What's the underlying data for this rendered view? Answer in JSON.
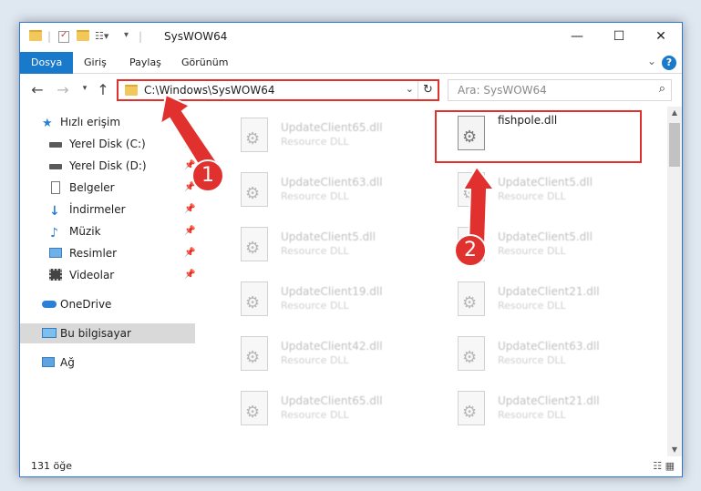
{
  "window": {
    "title": "SysWOW64",
    "minimize_glyph": "—",
    "maximize_glyph": "☐",
    "close_glyph": "✕"
  },
  "ribbon": {
    "tabs": [
      {
        "label": "Dosya",
        "active": true
      },
      {
        "label": "Giriş",
        "active": false
      },
      {
        "label": "Paylaş",
        "active": false
      },
      {
        "label": "Görünüm",
        "active": false
      }
    ],
    "help_glyph": "?"
  },
  "address": {
    "path": "C:\\Windows\\SysWOW64",
    "search_placeholder": "Ara: SysWOW64"
  },
  "sidebar": {
    "items": [
      {
        "label": "Hızlı erişim",
        "icon": "star-icon",
        "pinned": false
      },
      {
        "label": "Yerel Disk (C:)",
        "icon": "drive-icon",
        "pinned": true
      },
      {
        "label": "Yerel Disk (D:)",
        "icon": "drive-icon",
        "pinned": true
      },
      {
        "label": "Belgeler",
        "icon": "documents-icon",
        "pinned": true
      },
      {
        "label": "İndirmeler",
        "icon": "download-icon",
        "pinned": true
      },
      {
        "label": "Müzik",
        "icon": "music-icon",
        "pinned": true
      },
      {
        "label": "Resimler",
        "icon": "pictures-icon",
        "pinned": true
      },
      {
        "label": "Videolar",
        "icon": "videos-icon",
        "pinned": true
      },
      {
        "label": "OneDrive",
        "icon": "cloud-icon",
        "pinned": false
      },
      {
        "label": "Bu bilgisayar",
        "icon": "computer-icon",
        "pinned": false,
        "selected": true
      },
      {
        "label": "Ağ",
        "icon": "network-icon",
        "pinned": false
      }
    ]
  },
  "files": {
    "left": [
      {
        "name": "UpdateClient65.dll",
        "type": "Resource DLL"
      },
      {
        "name": "UpdateClient63.dll",
        "type": "Resource DLL"
      },
      {
        "name": "UpdateClient5.dll",
        "type": "Resource DLL"
      },
      {
        "name": "UpdateClient19.dll",
        "type": "Resource DLL"
      },
      {
        "name": "UpdateClient42.dll",
        "type": "Resource DLL"
      },
      {
        "name": "UpdateClient65.dll",
        "type": "Resource DLL"
      }
    ],
    "right": [
      {
        "name": "fishpole.dll",
        "type": ""
      },
      {
        "name": "UpdateClient5.dll",
        "type": "Resource DLL"
      },
      {
        "name": "UpdateClient5.dll",
        "type": "Resource DLL"
      },
      {
        "name": "UpdateClient21.dll",
        "type": "Resource DLL"
      },
      {
        "name": "UpdateClient63.dll",
        "type": "Resource DLL"
      },
      {
        "name": "UpdateClient21.dll",
        "type": "Resource DLL"
      }
    ]
  },
  "status": {
    "count": "131 öğe"
  },
  "callouts": {
    "one": "1",
    "two": "2",
    "color": "#e0312f"
  }
}
